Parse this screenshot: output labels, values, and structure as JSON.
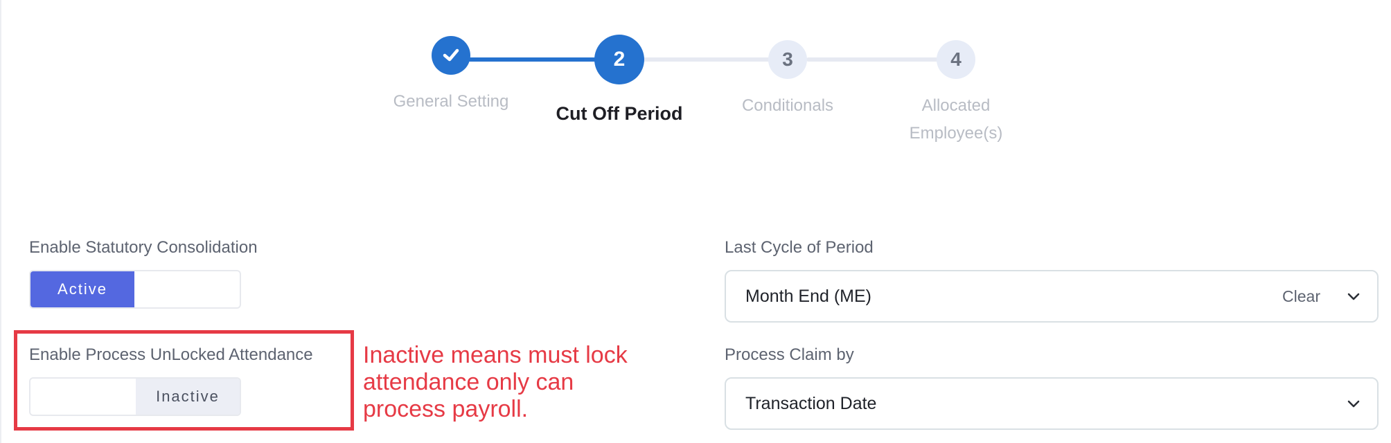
{
  "stepper": {
    "steps": [
      {
        "number": "",
        "label": "General Setting",
        "status": "done",
        "icon": "check-icon"
      },
      {
        "number": "2",
        "label": "Cut Off Period",
        "status": "current"
      },
      {
        "number": "3",
        "label": "Conditionals",
        "status": "todo"
      },
      {
        "number": "4",
        "label_line1": "Allocated",
        "label_line2": "Employee(s)",
        "status": "todo"
      }
    ]
  },
  "form": {
    "statutory": {
      "label": "Enable Statutory Consolidation",
      "state_label": "Active"
    },
    "unlocked_attendance": {
      "label": "Enable Process UnLocked Attendance",
      "state_label": "Inactive"
    },
    "last_cycle": {
      "label": "Last Cycle of Period",
      "value": "Month End (ME)",
      "clear_label": "Clear",
      "icon": "chevron-down-icon"
    },
    "process_claim": {
      "label": "Process Claim by",
      "value": "Transaction Date",
      "icon": "chevron-down-icon"
    }
  },
  "annotation": {
    "note": "Inactive means must lock attendance only can process payroll."
  },
  "colors": {
    "primary": "#2572cf",
    "toggle_active": "#5468e0",
    "annotation": "#e63a45"
  }
}
